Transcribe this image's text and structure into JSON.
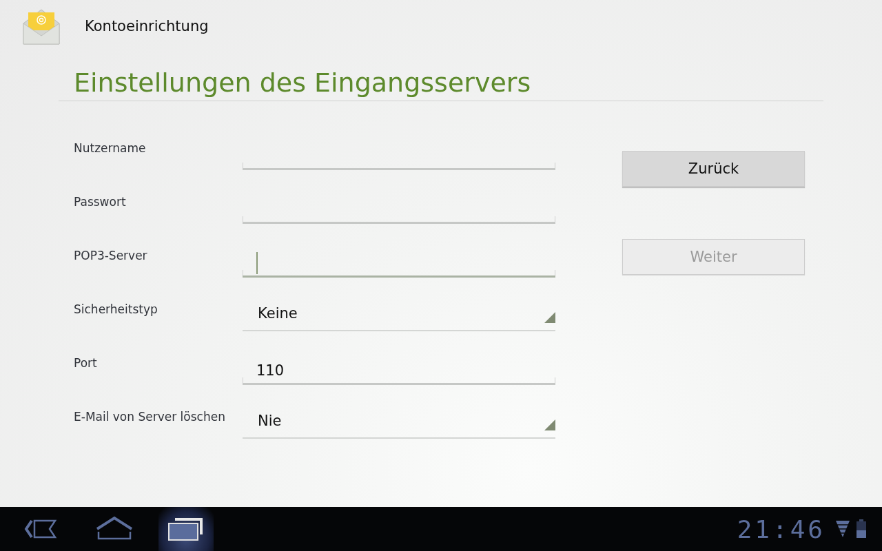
{
  "app_bar": {
    "title": "Kontoeinrichtung"
  },
  "heading": "Einstellungen des Eingangsservers",
  "fields": [
    {
      "kind": "text",
      "label": "Nutzername",
      "focused": false
    },
    {
      "kind": "text",
      "label": "Passwort",
      "focused": false
    },
    {
      "kind": "text",
      "label": "POP3-Server",
      "focused": true
    },
    {
      "kind": "dropdown",
      "label": "Sicherheitstyp",
      "value": "Keine"
    },
    {
      "kind": "text",
      "label": "Port",
      "value": "110",
      "focused": false
    },
    {
      "kind": "dropdown",
      "label": "E-Mail von Server löschen",
      "value": "Nie"
    }
  ],
  "buttons": [
    {
      "label": "Zurück",
      "disabled": false
    },
    {
      "label": "Weiter",
      "disabled": true
    }
  ],
  "nav_bar": {
    "buttons": [
      {
        "kind": "back",
        "selected": false
      },
      {
        "kind": "home",
        "selected": false
      },
      {
        "kind": "recents",
        "selected": true
      }
    ],
    "clock": "21:46"
  }
}
